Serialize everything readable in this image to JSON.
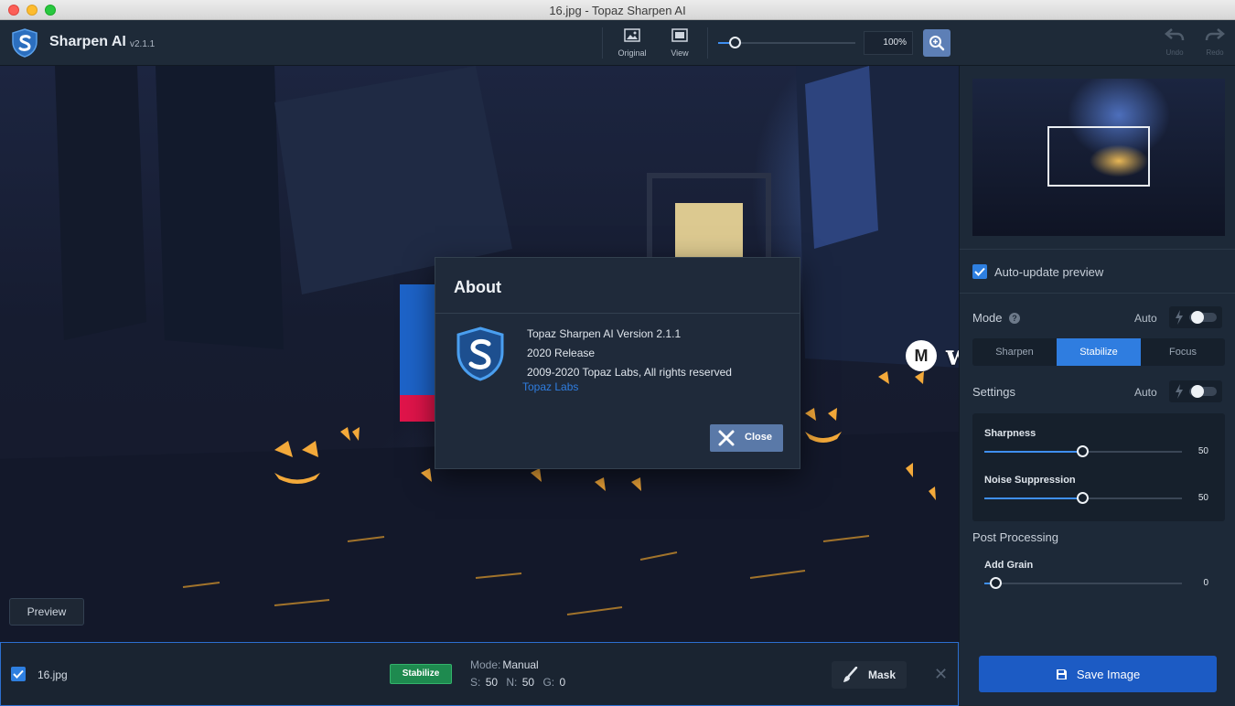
{
  "window": {
    "title": "16.jpg - Topaz Sharpen AI"
  },
  "brand": {
    "name": "Sharpen AI",
    "version": "v2.1.1"
  },
  "toolbar": {
    "original_label": "Original",
    "view_label": "View",
    "zoom_value": "100%",
    "zoom_slider_level": 0.12,
    "undo_label": "Undo",
    "redo_label": "Redo"
  },
  "canvas": {
    "preview_label": "Preview",
    "watermark_badge": "M",
    "watermark_text": "www.MacZ.com"
  },
  "panel": {
    "auto_update_label": "Auto-update preview",
    "auto_update_checked": true,
    "mode_label": "Mode",
    "mode_auto": "Auto",
    "mode_options": [
      "Sharpen",
      "Stabilize",
      "Focus"
    ],
    "mode_active": "Stabilize",
    "settings_label": "Settings",
    "settings_auto": "Auto",
    "sharpness_label": "Sharpness",
    "sharpness_value": "50",
    "noise_label": "Noise Suppression",
    "noise_value": "50",
    "post_processing_label": "Post Processing",
    "grain_label": "Add Grain",
    "grain_value": "0"
  },
  "bottom": {
    "file_name": "16.jpg",
    "file_checked": true,
    "badge": "Stabilize",
    "mode_prefix": "Mode:",
    "mode_value": "Manual",
    "s_prefix": "S:",
    "s_value": "50",
    "n_prefix": "N:",
    "n_value": "50",
    "g_prefix": "G:",
    "g_value": "0",
    "mask_label": "Mask",
    "save_label": "Save Image"
  },
  "about": {
    "title": "About",
    "line1": "Topaz Sharpen AI Version 2.1.1",
    "line2": "2020 Release",
    "line3": "2009-2020 Topaz Labs, All rights reserved",
    "link": "Topaz Labs",
    "close_label": "Close"
  },
  "colors": {
    "accent": "#2f7de0",
    "save_button": "#1c5bc4",
    "badge_green": "#1e8a4f",
    "dialog_bg": "#1f2a3a"
  }
}
